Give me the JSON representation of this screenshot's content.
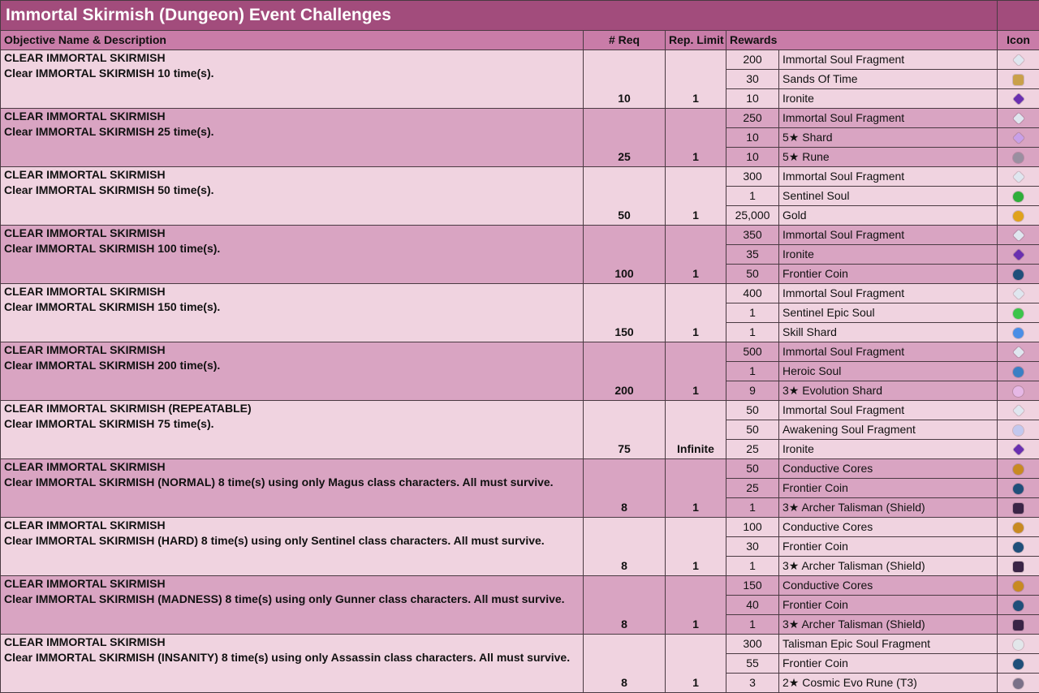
{
  "title": "Immortal Skirmish (Dungeon) Event Challenges",
  "headers": {
    "objective": "Objective Name & Description",
    "req": "# Req",
    "limit": "Rep. Limit",
    "rewards": "Rewards",
    "icon": "Icon"
  },
  "challenges": [
    {
      "name": "CLEAR IMMORTAL SKIRMISH",
      "desc": "Clear IMMORTAL SKIRMISH 10 time(s).",
      "req": "10",
      "limit": "1",
      "rewards": [
        {
          "qty": "200",
          "item": "Immortal Soul Fragment",
          "icon": "soul-fragment-icon",
          "color": "#dfe6ef"
        },
        {
          "qty": "30",
          "item": "Sands Of Time",
          "icon": "hourglass-icon",
          "color": "#c9a04a"
        },
        {
          "qty": "10",
          "item": "Ironite",
          "icon": "ironite-icon",
          "color": "#6a2fb0"
        }
      ]
    },
    {
      "name": "CLEAR IMMORTAL SKIRMISH",
      "desc": "Clear IMMORTAL SKIRMISH 25 time(s).",
      "req": "25",
      "limit": "1",
      "rewards": [
        {
          "qty": "250",
          "item": "Immortal Soul Fragment",
          "icon": "soul-fragment-icon",
          "color": "#dfe6ef"
        },
        {
          "qty": "10",
          "item": "5★ Shard",
          "icon": "shard-icon",
          "color": "#c8a0e8"
        },
        {
          "qty": "10",
          "item": "5★ Rune",
          "icon": "rune-icon",
          "color": "#9a8fa0"
        }
      ]
    },
    {
      "name": "CLEAR IMMORTAL SKIRMISH",
      "desc": "Clear IMMORTAL SKIRMISH 50 time(s).",
      "req": "50",
      "limit": "1",
      "rewards": [
        {
          "qty": "300",
          "item": "Immortal Soul Fragment",
          "icon": "soul-fragment-icon",
          "color": "#dfe6ef"
        },
        {
          "qty": "1",
          "item": "Sentinel Soul",
          "icon": "sentinel-soul-icon",
          "color": "#2fae3a"
        },
        {
          "qty": "25,000",
          "item": "Gold",
          "icon": "gold-icon",
          "color": "#e0a21c"
        }
      ]
    },
    {
      "name": "CLEAR IMMORTAL SKIRMISH",
      "desc": "Clear IMMORTAL SKIRMISH 100 time(s).",
      "req": "100",
      "limit": "1",
      "rewards": [
        {
          "qty": "350",
          "item": "Immortal Soul Fragment",
          "icon": "soul-fragment-icon",
          "color": "#dfe6ef"
        },
        {
          "qty": "35",
          "item": "Ironite",
          "icon": "ironite-icon",
          "color": "#6a2fb0"
        },
        {
          "qty": "50",
          "item": "Frontier Coin",
          "icon": "frontier-coin-icon",
          "color": "#1f4f7a"
        }
      ]
    },
    {
      "name": "CLEAR IMMORTAL SKIRMISH",
      "desc": "Clear IMMORTAL SKIRMISH 150 time(s).",
      "req": "150",
      "limit": "1",
      "rewards": [
        {
          "qty": "400",
          "item": "Immortal Soul Fragment",
          "icon": "soul-fragment-icon",
          "color": "#dfe6ef"
        },
        {
          "qty": "1",
          "item": "Sentinel Epic Soul",
          "icon": "sentinel-epic-soul-icon",
          "color": "#3cc44a"
        },
        {
          "qty": "1",
          "item": "Skill Shard",
          "icon": "skill-shard-icon",
          "color": "#4a8ee6"
        }
      ]
    },
    {
      "name": "CLEAR IMMORTAL SKIRMISH",
      "desc": "Clear IMMORTAL SKIRMISH 200 time(s).",
      "req": "200",
      "limit": "1",
      "rewards": [
        {
          "qty": "500",
          "item": "Immortal Soul Fragment",
          "icon": "soul-fragment-icon",
          "color": "#dfe6ef"
        },
        {
          "qty": "1",
          "item": "Heroic Soul",
          "icon": "heroic-soul-icon",
          "color": "#3a7fc4"
        },
        {
          "qty": "9",
          "item": "3★ Evolution Shard",
          "icon": "evolution-shard-icon",
          "color": "#e6b8e6"
        }
      ]
    },
    {
      "name": "CLEAR IMMORTAL SKIRMISH (REPEATABLE)",
      "desc": "Clear IMMORTAL SKIRMISH 75 time(s).",
      "req": "75",
      "limit": "Infinite",
      "rewards": [
        {
          "qty": "50",
          "item": "Immortal Soul Fragment",
          "icon": "soul-fragment-icon",
          "color": "#dfe6ef"
        },
        {
          "qty": "50",
          "item": "Awakening Soul Fragment",
          "icon": "awakening-fragment-icon",
          "color": "#c2c8ee"
        },
        {
          "qty": "25",
          "item": "Ironite",
          "icon": "ironite-icon",
          "color": "#6a2fb0"
        }
      ]
    },
    {
      "name": "CLEAR IMMORTAL SKIRMISH",
      "desc": "Clear IMMORTAL SKIRMISH (NORMAL) 8 time(s) using only Magus class characters. All must survive.",
      "req": "8",
      "limit": "1",
      "rewards": [
        {
          "qty": "50",
          "item": "Conductive Cores",
          "icon": "conductive-core-icon",
          "color": "#c88a22"
        },
        {
          "qty": "25",
          "item": "Frontier Coin",
          "icon": "frontier-coin-icon",
          "color": "#1f4f7a"
        },
        {
          "qty": "1",
          "item": "3★ Archer Talisman (Shield)",
          "icon": "talisman-icon",
          "color": "#3a2446"
        }
      ]
    },
    {
      "name": "CLEAR IMMORTAL SKIRMISH",
      "desc": "Clear IMMORTAL SKIRMISH (HARD) 8 time(s) using only Sentinel class characters. All must survive.",
      "req": "8",
      "limit": "1",
      "rewards": [
        {
          "qty": "100",
          "item": "Conductive Cores",
          "icon": "conductive-core-icon",
          "color": "#c88a22"
        },
        {
          "qty": "30",
          "item": "Frontier Coin",
          "icon": "frontier-coin-icon",
          "color": "#1f4f7a"
        },
        {
          "qty": "1",
          "item": "3★ Archer Talisman (Shield)",
          "icon": "talisman-icon",
          "color": "#3a2446"
        }
      ]
    },
    {
      "name": "CLEAR IMMORTAL SKIRMISH",
      "desc": "Clear IMMORTAL SKIRMISH (MADNESS) 8 time(s) using only Gunner class characters. All must survive.",
      "req": "8",
      "limit": "1",
      "rewards": [
        {
          "qty": "150",
          "item": "Conductive Cores",
          "icon": "conductive-core-icon",
          "color": "#c88a22"
        },
        {
          "qty": "40",
          "item": "Frontier Coin",
          "icon": "frontier-coin-icon",
          "color": "#1f4f7a"
        },
        {
          "qty": "1",
          "item": "3★ Archer Talisman (Shield)",
          "icon": "talisman-icon",
          "color": "#3a2446"
        }
      ]
    },
    {
      "name": "CLEAR IMMORTAL SKIRMISH",
      "desc": "Clear IMMORTAL SKIRMISH (INSANITY) 8 time(s) using only Assassin class characters. All must survive.",
      "req": "8",
      "limit": "1",
      "rewards": [
        {
          "qty": "300",
          "item": "Talisman Epic Soul Fragment",
          "icon": "talisman-fragment-icon",
          "color": "#e2e6ea"
        },
        {
          "qty": "55",
          "item": "Frontier Coin",
          "icon": "frontier-coin-icon",
          "color": "#1f4f7a"
        },
        {
          "qty": "3",
          "item": "2★ Cosmic Evo Rune (T3)",
          "icon": "cosmic-rune-icon",
          "color": "#7a7088"
        }
      ]
    }
  ]
}
